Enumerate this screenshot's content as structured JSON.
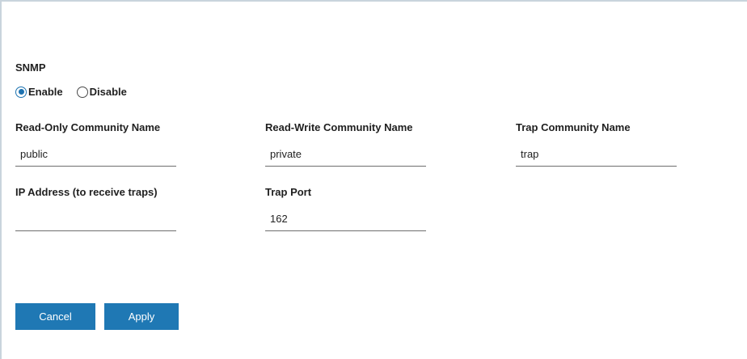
{
  "snmp": {
    "title": "SNMP",
    "options": [
      {
        "label": "Enable",
        "checked": true
      },
      {
        "label": "Disable",
        "checked": false
      }
    ]
  },
  "fields": {
    "read_only": {
      "label": "Read-Only Community Name",
      "value": "public"
    },
    "read_write": {
      "label": "Read-Write Community Name",
      "value": "private"
    },
    "trap_community": {
      "label": "Trap Community Name",
      "value": "trap"
    },
    "ip_address": {
      "label": "IP Address (to receive traps)",
      "value": ""
    },
    "trap_port": {
      "label": "Trap Port",
      "value": "162"
    }
  },
  "buttons": {
    "cancel": "Cancel",
    "apply": "Apply"
  },
  "colors": {
    "accent": "#1f78b4",
    "frame_border": "#c9d4dd"
  }
}
